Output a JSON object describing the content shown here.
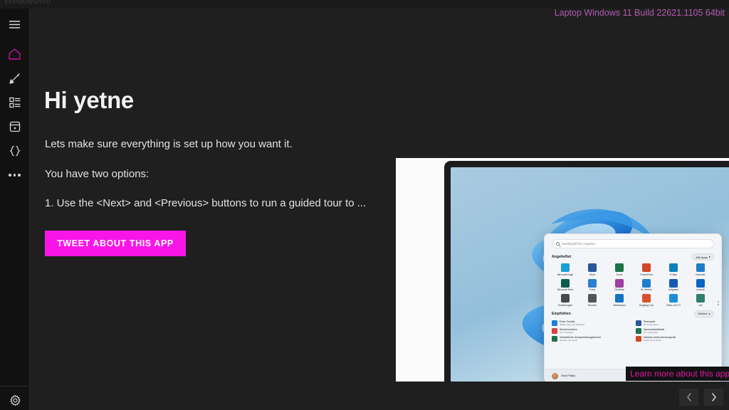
{
  "window": {
    "app_title": "WindowsInfo",
    "system_info": "Laptop Windows 11 Build 22621.1105 64bit"
  },
  "sidebar": {
    "items": [
      {
        "icon": "hamburger-menu-icon",
        "name": "menu",
        "selected": false
      },
      {
        "icon": "home-icon",
        "name": "home",
        "selected": true
      },
      {
        "icon": "brush-icon",
        "name": "personalization",
        "selected": false
      },
      {
        "icon": "sliders-icon",
        "name": "settings-list",
        "selected": false
      },
      {
        "icon": "box-icon",
        "name": "apps",
        "selected": false
      },
      {
        "icon": "code-braces-icon",
        "name": "developer",
        "selected": false
      },
      {
        "icon": "more-dots-icon",
        "name": "more",
        "selected": false
      }
    ],
    "footer": {
      "icon": "gear-icon",
      "name": "settings"
    }
  },
  "main": {
    "greeting": "Hi yetne",
    "line1": "Lets make sure everything is set up how you want it.",
    "line2": "You have two options:",
    "line3": "1. Use the <Next> and <Previous> buttons to run a guided tour to ...",
    "tweet_button": "TWEET ABOUT THIS APP"
  },
  "promo": {
    "learn_more": "Learn more about this app...",
    "start_menu": {
      "search_placeholder": "Suchbegriff hier eingeben",
      "pinned_title": "Angeheftet",
      "pinned_more": "Alle Apps",
      "pinned_apps": [
        {
          "name": "Microsoft Edge",
          "color": "#1a9fd6"
        },
        {
          "name": "Word",
          "color": "#2b5797"
        },
        {
          "name": "Excel",
          "color": "#1e7145"
        },
        {
          "name": "PowerPoint",
          "color": "#d24726"
        },
        {
          "name": "E-Mail",
          "color": "#0f7ebd"
        },
        {
          "name": "Kalender",
          "color": "#1d7dc4"
        },
        {
          "name": "Microsoft Store",
          "color": "#0c5b52"
        },
        {
          "name": "Fotos",
          "color": "#2b7fd1"
        },
        {
          "name": "OneNote",
          "color": "#9b3fa0"
        },
        {
          "name": "Ihr Telefon",
          "color": "#1f7ed0"
        },
        {
          "name": "Aufgaben",
          "color": "#1559b5"
        },
        {
          "name": "LinkedIn",
          "color": "#0a66c2"
        },
        {
          "name": "Einstellungen",
          "color": "#46494d"
        },
        {
          "name": "Rechner",
          "color": "#4f555b"
        },
        {
          "name": "Whiteboard",
          "color": "#1474c6"
        },
        {
          "name": "Snipping Tool",
          "color": "#d9512c"
        },
        {
          "name": "Filme und TV",
          "color": "#1a8fd8"
        },
        {
          "name": "Uhr",
          "color": "#2e7d6f"
        }
      ],
      "recommended_title": "Empfohlen",
      "recommended_more": "Weitere",
      "recommended": [
        {
          "title": "Erste Schritte",
          "sub": "Willkommen bei Windows",
          "color": "#1b7fd4"
        },
        {
          "title": "Reisenotiz",
          "sub": "Vor 10 Stunden",
          "color": "#2b5797"
        },
        {
          "title": "Wochennotizen",
          "sub": "Vor 2 Stunden",
          "color": "#d9433c"
        },
        {
          "title": "Spesenarbeitsblatt",
          "sub": "Vor 10 Stunden",
          "color": "#1e7145"
        },
        {
          "title": "Vertriebliche Umsatzleistungsbericht",
          "sub": "Gestern um 14:34",
          "color": "#1e7145"
        },
        {
          "title": "Adresse Unternehmensprofil",
          "sub": "Gestern um 13:10",
          "color": "#d24726"
        }
      ],
      "user_name": "Sara Philips"
    }
  },
  "pager": {
    "previous_label": "Previous",
    "next_label": "Next"
  },
  "colors": {
    "accent_magenta": "#f915e8",
    "accent_purple": "#b05ab0",
    "selected_icon": "#c0149b",
    "background": "#1f1f1f",
    "sidebar": "#111111"
  }
}
